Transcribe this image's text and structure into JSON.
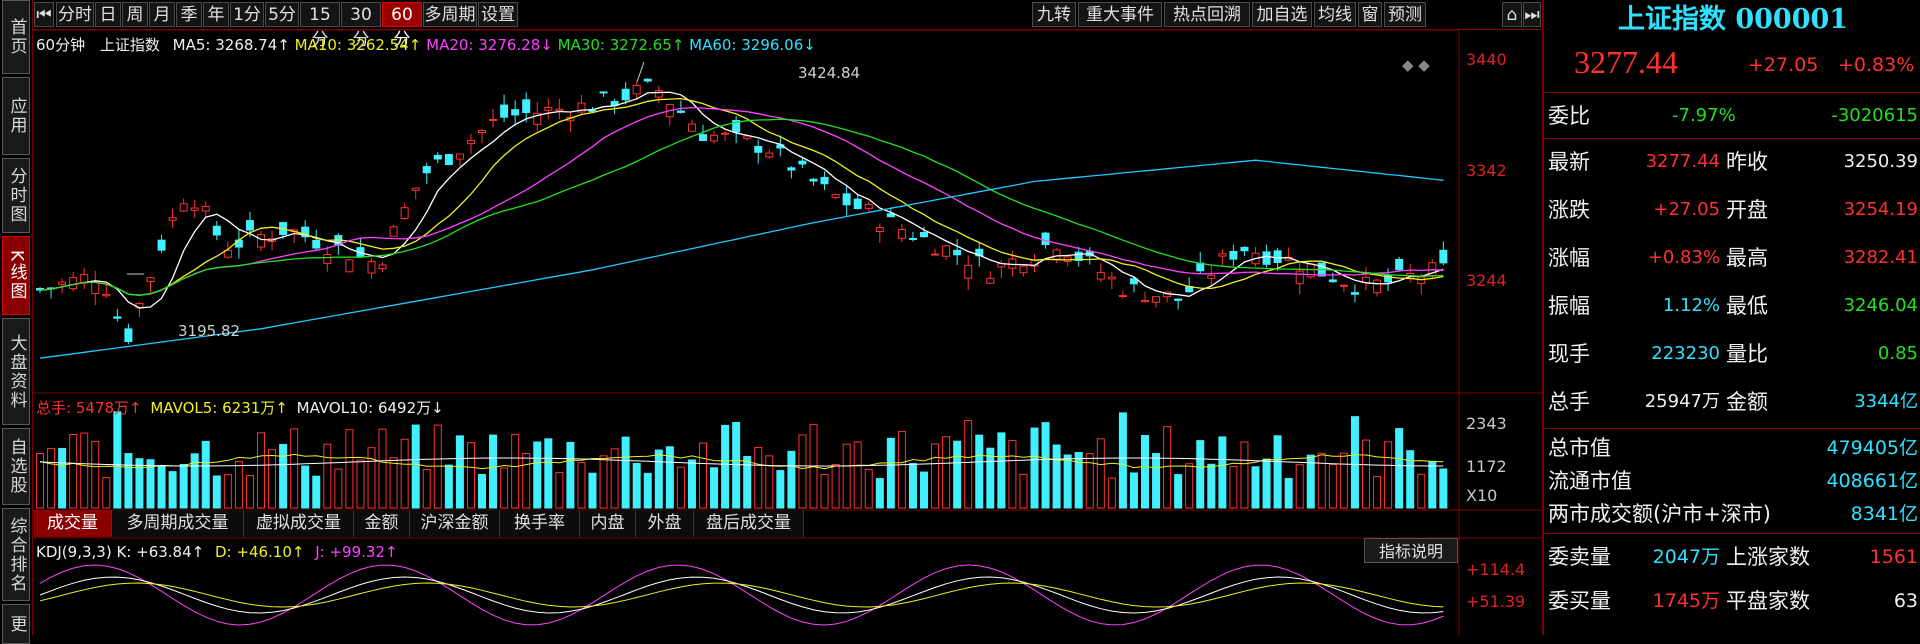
{
  "left_tabs": [
    {
      "label": "首页",
      "active": false
    },
    {
      "label": "应用",
      "active": false
    },
    {
      "label": "分时图",
      "active": false
    },
    {
      "label": "K线图",
      "active": true
    },
    {
      "label": "大盘资料",
      "active": false
    },
    {
      "label": "自选股",
      "active": false
    },
    {
      "label": "综合排名",
      "active": false
    },
    {
      "label": "更",
      "active": false
    }
  ],
  "toolbar": {
    "left": [
      "分时",
      "日",
      "周",
      "月",
      "季",
      "年",
      "1分",
      "5分",
      "15分",
      "30分",
      "60分",
      "多周期",
      "设置"
    ],
    "active": "60分",
    "right": [
      "九转",
      "重大事件",
      "热点回溯",
      "加自选",
      "均线",
      "窗",
      "预测"
    ]
  },
  "main_legend": {
    "period": "60分钟",
    "name": "上证指数",
    "ma5": "MA5: 3268.74↑",
    "ma10": "MA10: 3262.54↑",
    "ma20": "MA20: 3276.28↓",
    "ma30": "MA30: 3272.65↑",
    "ma60": "MA60: 3296.06↓"
  },
  "price_axis": [
    "3440",
    "3342",
    "3244"
  ],
  "high_mark": "3424.84",
  "low_mark": "3195.82",
  "volume_legend": {
    "total": "总手: 5478万↑",
    "mavol5": "MAVOL5: 6231万↑",
    "mavol10": "MAVOL10: 6492万↓"
  },
  "volume_axis": [
    "2343",
    "1172",
    "X10"
  ],
  "bottom_tabs": [
    "成交量",
    "多周期成交量",
    "虚拟成交量",
    "金额",
    "沪深金额",
    "换手率",
    "内盘",
    "外盘",
    "盘后成交量"
  ],
  "bottom_active": "成交量",
  "kdj_legend": {
    "name": "KDJ(9,3,3)",
    "k": "K: +63.84↑",
    "d": "D: +46.10↑",
    "j": "J: +99.32↑"
  },
  "indicator_button": "指标说明",
  "kdj_axis": [
    "+114.4",
    "+51.39"
  ],
  "colors": {
    "up": "#ff3030",
    "down": "#40f0ff",
    "ma5": "#ffffff",
    "ma10": "#f0f020",
    "ma20": "#ff40ff",
    "ma30": "#20e020",
    "ma60": "#20c8ff"
  },
  "right_panel": {
    "title": "上证指数 000001",
    "price": "3277.44",
    "change": "+27.05",
    "change_pct": "+0.83%",
    "weibi": {
      "label": "委比",
      "pct": "-7.97%",
      "val": "-3020615"
    },
    "rows": [
      {
        "l1": "最新",
        "v1": "3277.44",
        "c1": "red",
        "l2": "昨收",
        "v2": "3250.39",
        "c2": "white"
      },
      {
        "l1": "涨跌",
        "v1": "+27.05",
        "c1": "red",
        "l2": "开盘",
        "v2": "3254.19",
        "c2": "red"
      },
      {
        "l1": "涨幅",
        "v1": "+0.83%",
        "c1": "red",
        "l2": "最高",
        "v2": "3282.41",
        "c2": "red"
      },
      {
        "l1": "振幅",
        "v1": "1.12%",
        "c1": "cyan",
        "l2": "最低",
        "v2": "3246.04",
        "c2": "green"
      },
      {
        "l1": "现手",
        "v1": "223230",
        "c1": "cyan",
        "l2": "量比",
        "v2": "0.85",
        "c2": "green"
      },
      {
        "l1": "总手",
        "v1": "25947万",
        "c1": "white",
        "l2": "金额",
        "v2": "3344亿",
        "c2": "cyan"
      }
    ],
    "market": [
      {
        "label": "总市值",
        "val": "479405亿"
      },
      {
        "label": "流通市值",
        "val": "408661亿"
      },
      {
        "label": "两市成交额(沪市+深市)",
        "val": "8341亿"
      }
    ],
    "orders": [
      {
        "l1": "委卖量",
        "v1": "2047万",
        "c1": "cyan",
        "l2": "上涨家数",
        "v2": "1561",
        "c2": "red"
      },
      {
        "l1": "委买量",
        "v1": "1745万",
        "c1": "red",
        "l2": "平盘家数",
        "v2": "63",
        "c2": "white"
      }
    ]
  }
}
